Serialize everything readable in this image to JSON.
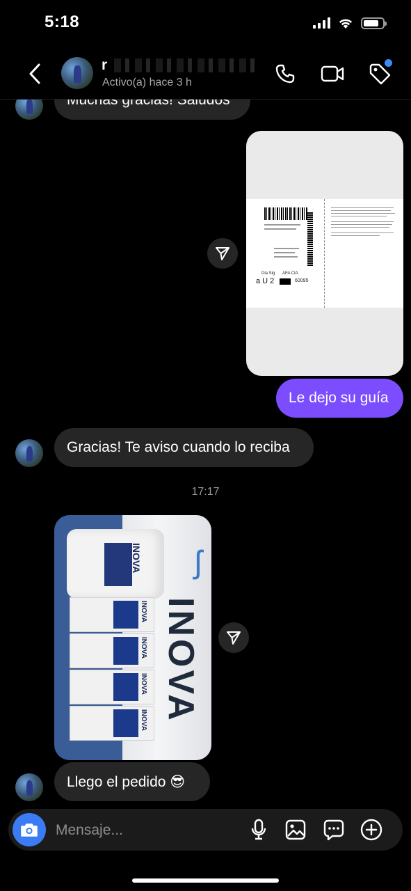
{
  "status_bar": {
    "time": "5:18"
  },
  "header": {
    "name_initial": "r",
    "status": "Activo(a) hace 3 h"
  },
  "messages": [
    {
      "direction": "in",
      "text": "Muchas gracias! Saludos"
    },
    {
      "direction": "out",
      "type": "image",
      "description": "shipping-label"
    },
    {
      "direction": "out",
      "text": "Le dejo su guía"
    },
    {
      "direction": "in",
      "text": "Gracias! Te aviso cuando lo reciba"
    },
    {
      "direction": "in",
      "type": "image",
      "description": "product-photo"
    },
    {
      "direction": "in",
      "text": "Llego el pedido 😎"
    }
  ],
  "shipping_label": {
    "line_big": "a U 2",
    "code": "60095",
    "origin": "Dia Sig",
    "route": "AFA   CIA"
  },
  "product_photo": {
    "towel_brand": "INOVA",
    "bottle_brand": "INOVA",
    "box_brand": "INOVA"
  },
  "timestamp": "17:17",
  "composer": {
    "placeholder": "Mensaje..."
  },
  "colors": {
    "outgoing_bubble": "#7c4dff",
    "incoming_bubble": "#262626",
    "accent": "#3b7cf5"
  }
}
